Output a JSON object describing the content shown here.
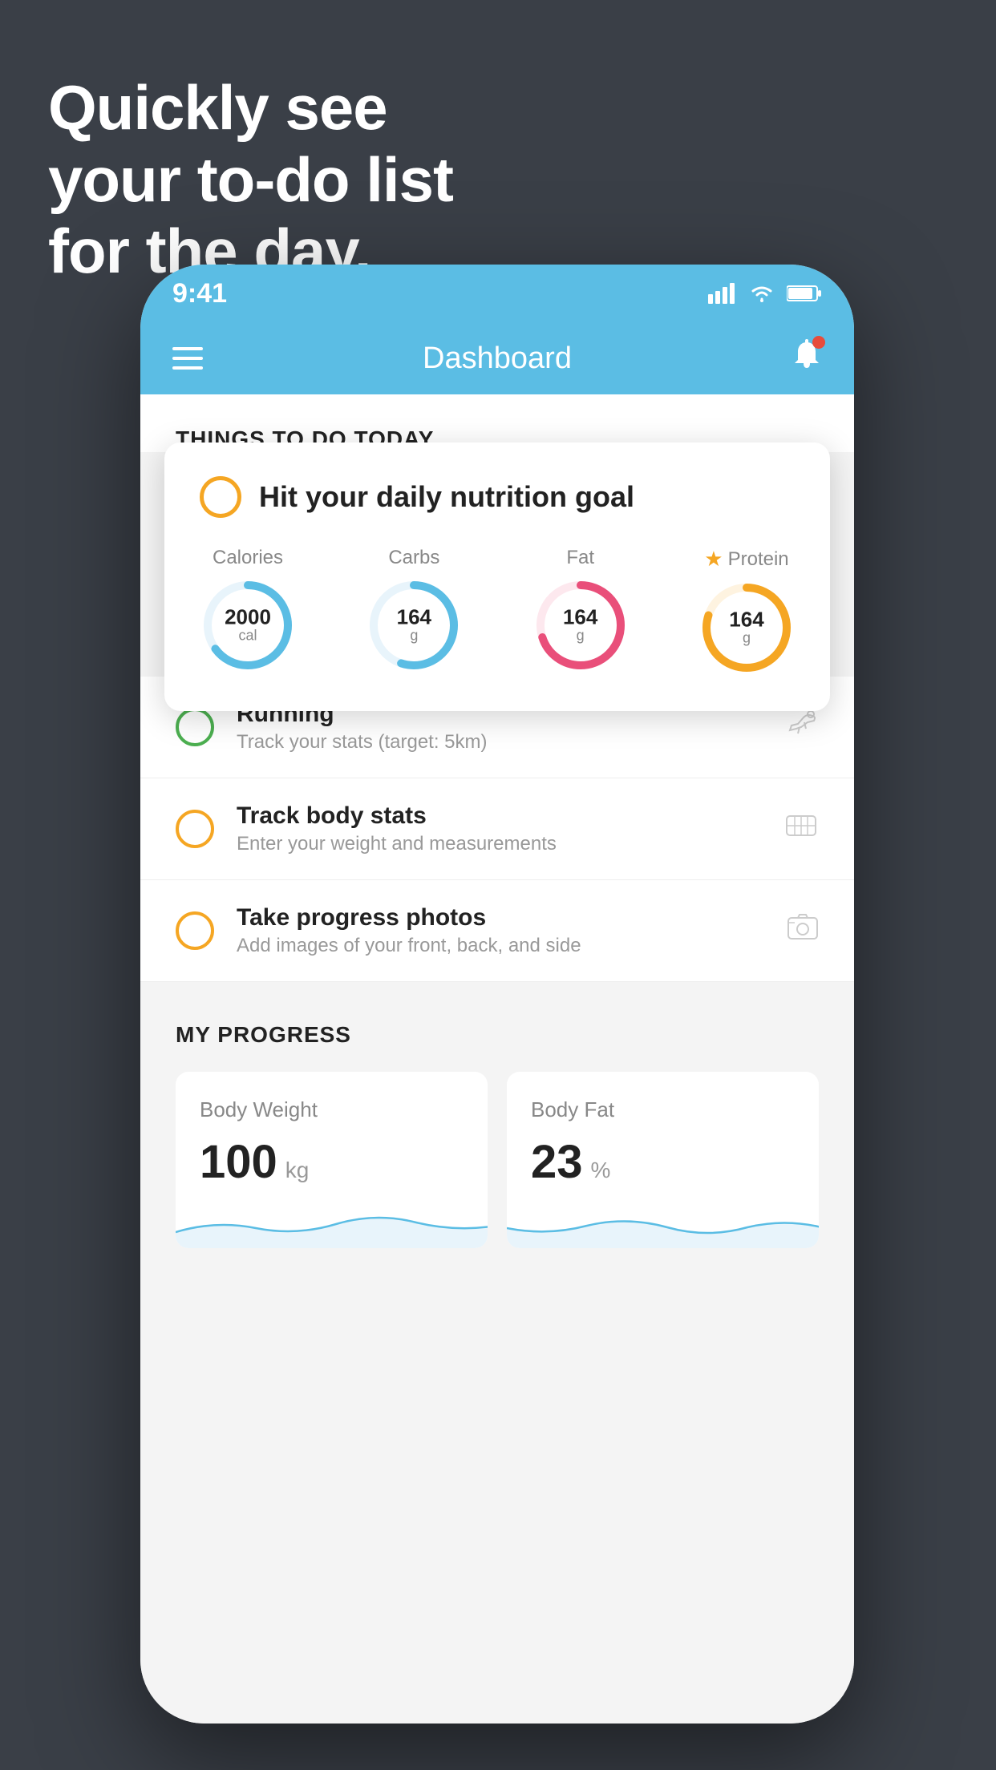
{
  "headline": {
    "line1": "Quickly see",
    "line2": "your to-do list",
    "line3": "for the day."
  },
  "status_bar": {
    "time": "9:41",
    "signal": "▋▋▋▋",
    "wifi": "wifi",
    "battery": "battery"
  },
  "header": {
    "title": "Dashboard"
  },
  "section_today": {
    "title": "THINGS TO DO TODAY"
  },
  "floating_card": {
    "circle_color": "#f5a623",
    "title": "Hit your daily nutrition goal",
    "nutrients": [
      {
        "label": "Calories",
        "value": "2000",
        "unit": "cal",
        "color": "#5bbde4",
        "percent": 65
      },
      {
        "label": "Carbs",
        "value": "164",
        "unit": "g",
        "color": "#5bbde4",
        "percent": 55
      },
      {
        "label": "Fat",
        "value": "164",
        "unit": "g",
        "color": "#e94f7a",
        "percent": 70
      },
      {
        "label": "Protein",
        "value": "164",
        "unit": "g",
        "color": "#f5a623",
        "percent": 80,
        "star": true
      }
    ]
  },
  "todo_items": [
    {
      "id": "running",
      "name": "Running",
      "desc": "Track your stats (target: 5km)",
      "circle_color": "green",
      "icon": "👟"
    },
    {
      "id": "track-body-stats",
      "name": "Track body stats",
      "desc": "Enter your weight and measurements",
      "circle_color": "yellow",
      "icon": "⚖️"
    },
    {
      "id": "progress-photos",
      "name": "Take progress photos",
      "desc": "Add images of your front, back, and side",
      "circle_color": "yellow",
      "icon": "🖼️"
    }
  ],
  "progress": {
    "section_title": "MY PROGRESS",
    "cards": [
      {
        "id": "body-weight",
        "title": "Body Weight",
        "value": "100",
        "unit": "kg"
      },
      {
        "id": "body-fat",
        "title": "Body Fat",
        "value": "23",
        "unit": "%"
      }
    ]
  }
}
